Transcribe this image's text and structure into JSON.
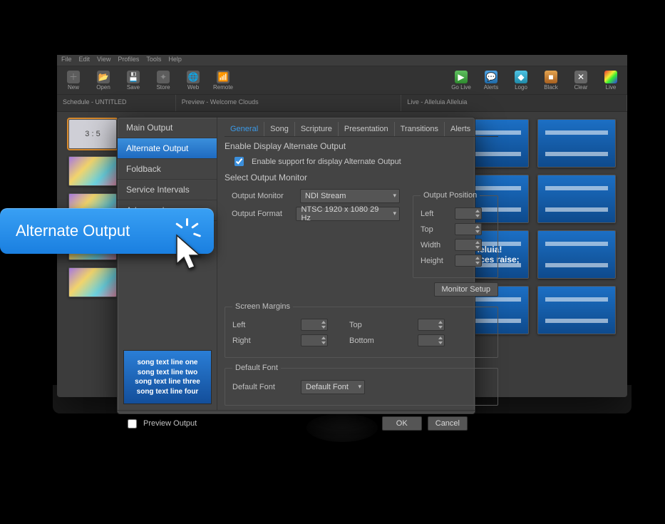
{
  "menu": {
    "items": [
      "File",
      "Edit",
      "View",
      "Profiles",
      "Tools",
      "Help"
    ]
  },
  "toolbar": {
    "left": [
      {
        "name": "new-button",
        "label": "New"
      },
      {
        "name": "open-button",
        "label": "Open"
      },
      {
        "name": "save-button",
        "label": "Save"
      },
      {
        "name": "store-button",
        "label": "Store"
      },
      {
        "name": "web-button",
        "label": "Web"
      },
      {
        "name": "remote-button",
        "label": "Remote"
      }
    ],
    "right": [
      {
        "name": "golive-button",
        "label": "Go Live",
        "cls": "c-green"
      },
      {
        "name": "alerts-button",
        "label": "Alerts",
        "cls": "c-blue"
      },
      {
        "name": "logo-button",
        "label": "Logo",
        "cls": "c-cyan"
      },
      {
        "name": "black-button",
        "label": "Black",
        "cls": "c-orange"
      },
      {
        "name": "clear-button",
        "label": "Clear",
        "cls": "c-clear"
      },
      {
        "name": "live-button",
        "label": "Live",
        "cls": "c-rainbow"
      }
    ]
  },
  "panels": {
    "schedule": "Schedule - UNTITLED",
    "preview": "Preview - Welcome Clouds",
    "live": "Live - Alleluia Alleluia",
    "label_welcome": "Welcome Clouds",
    "ratio": "3 : 5",
    "live_thumb_text": "leluia!\nd voices raise;"
  },
  "modal": {
    "sidebar": {
      "items": [
        {
          "label": "Main Output",
          "selected": false
        },
        {
          "label": "Alternate Output",
          "selected": true
        },
        {
          "label": "Foldback",
          "selected": false
        },
        {
          "label": "Service Intervals",
          "selected": false
        },
        {
          "label": "Advanced",
          "selected": false
        }
      ]
    },
    "preview_lines": [
      "song text line one",
      "song text line two",
      "song text line three",
      "song text line four"
    ],
    "tabs": [
      "General",
      "Song",
      "Scripture",
      "Presentation",
      "Transitions",
      "Alerts"
    ],
    "active_tab": 0,
    "section_enable_title": "Enable Display Alternate Output",
    "enable_checkbox_label": "Enable support for display Alternate Output",
    "enable_checked": true,
    "section_select_title": "Select Output Monitor",
    "output_monitor_label": "Output Monitor",
    "output_monitor_value": "NDI Stream",
    "output_format_label": "Output Format",
    "output_format_value": "NTSC 1920 x 1080 29 Hz",
    "output_position": {
      "legend": "Output Position",
      "fields": [
        "Left",
        "Top",
        "Width",
        "Height"
      ]
    },
    "monitor_setup": "Monitor Setup",
    "screen_margins": {
      "legend": "Screen Margins",
      "fields": [
        "Left",
        "Top",
        "Right",
        "Bottom"
      ]
    },
    "default_font": {
      "legend": "Default Font",
      "label": "Default Font",
      "value": "Default Font"
    },
    "footer": {
      "preview_output": "Preview Output",
      "ok": "OK",
      "cancel": "Cancel"
    }
  },
  "callout": {
    "text": "Alternate Output"
  }
}
